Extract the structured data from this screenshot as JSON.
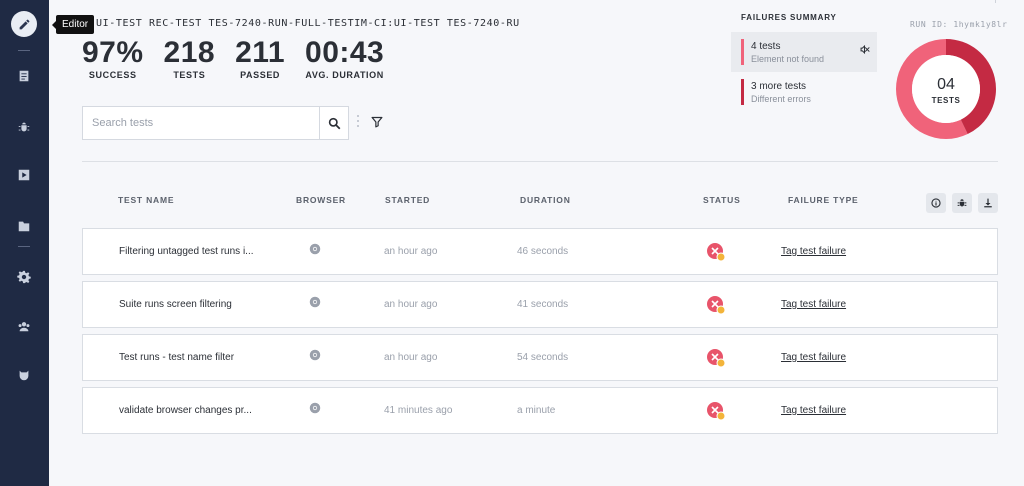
{
  "tooltip": "Editor",
  "run": {
    "title": "UI-TEST REC-TEST TES-7240-RUN-FULL-TESTIM-CI:UI-TEST TES-7240-RU",
    "run_id": "RUN ID: 1hymk1y8lr"
  },
  "stats": [
    {
      "value": "97%",
      "label": "SUCCESS"
    },
    {
      "value": "218",
      "label": "TESTS"
    },
    {
      "value": "211",
      "label": "PASSED"
    },
    {
      "value": "00:43",
      "label": "AVG. DURATION"
    }
  ],
  "search": {
    "placeholder": "Search tests"
  },
  "failures_summary": {
    "title": "FAILURES SUMMARY",
    "items": [
      {
        "count": "4 tests",
        "desc": "Element not found",
        "color": "#f0637a"
      },
      {
        "count": "3 more tests",
        "desc": "Different errors",
        "color": "#c42a43"
      }
    ],
    "donut": {
      "value": "04",
      "label": "TESTS",
      "segments": [
        4,
        3
      ],
      "colors": [
        "#f0637a",
        "#c42a43"
      ]
    }
  },
  "table": {
    "headers": [
      "TEST NAME",
      "BROWSER",
      "STARTED",
      "DURATION",
      "STATUS",
      "FAILURE TYPE"
    ],
    "rows": [
      {
        "name": "Filtering untagged test runs i...",
        "browser": "chrome-icon",
        "started": "an hour ago",
        "duration": "46 seconds",
        "status": "failed",
        "failure": "Tag test failure"
      },
      {
        "name": "Suite runs screen filtering",
        "browser": "chrome-icon",
        "started": "an hour ago",
        "duration": "41 seconds",
        "status": "failed",
        "failure": "Tag test failure"
      },
      {
        "name": "Test runs - test name filter",
        "browser": "chrome-icon",
        "started": "an hour ago",
        "duration": "54 seconds",
        "status": "failed",
        "failure": "Tag test failure"
      },
      {
        "name": "validate browser changes pr...",
        "browser": "chrome-icon",
        "started": "41 minutes ago",
        "duration": "a minute",
        "status": "failed",
        "failure": "Tag test failure"
      }
    ]
  },
  "colors": {
    "sidebar": "#1f2a44",
    "fail": "#e8546a",
    "warn": "#f3b43a"
  }
}
